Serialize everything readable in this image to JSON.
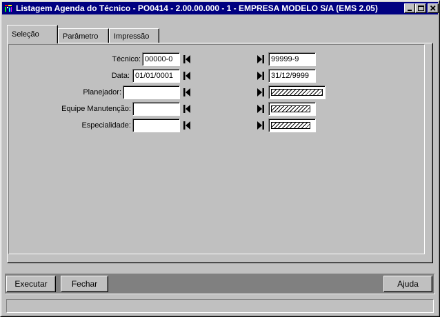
{
  "window": {
    "title": "Listagem Agenda do Técnico - PO0414 - 2.00.00.000 - 1 - EMPRESA MODELO S/A (EMS 2.05)",
    "icon": "app-icon",
    "controls": [
      "minimize-icon",
      "maximize-icon",
      "close-icon"
    ]
  },
  "tabs": [
    {
      "label": "Seleção",
      "active": true
    },
    {
      "label": "Parâmetro",
      "active": false
    },
    {
      "label": "Impressão",
      "active": false
    }
  ],
  "form": {
    "rows": [
      {
        "label": "Técnico:",
        "from": "00000-0",
        "to": "99999-9",
        "to_hatched": false
      },
      {
        "label": "Data:",
        "from": "01/01/0001",
        "to": "31/12/9999",
        "to_hatched": false
      },
      {
        "label": "Planejador:",
        "from": "",
        "to": "",
        "to_hatched": true
      },
      {
        "label": "Equipe Manutenção:",
        "from": "",
        "to": "",
        "to_hatched": true
      },
      {
        "label": "Especialidade:",
        "from": "",
        "to": "",
        "to_hatched": true
      }
    ],
    "icons": {
      "first": "first-record-icon",
      "last": "last-record-icon"
    }
  },
  "buttons": {
    "executar": "Executar",
    "fechar": "Fechar",
    "ajuda": "Ajuda"
  },
  "colors": {
    "titlebar": "#000080",
    "face": "#c0c0c0",
    "shadow": "#808080",
    "field": "#ffffff"
  }
}
